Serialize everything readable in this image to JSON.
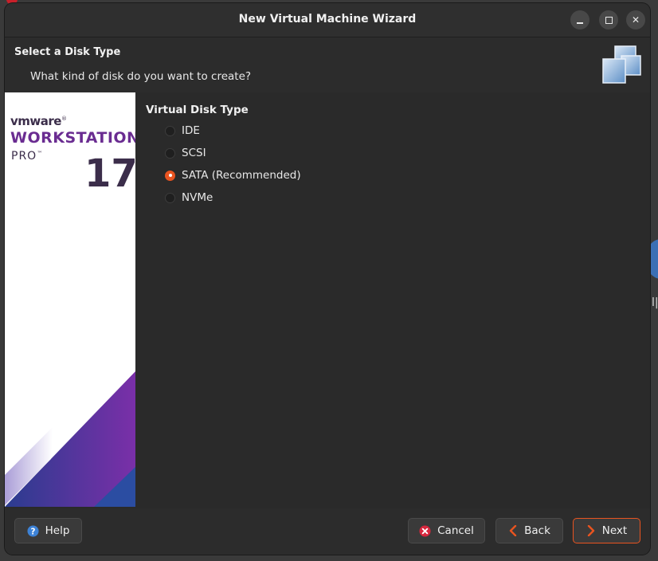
{
  "window": {
    "title": "New Virtual Machine Wizard"
  },
  "header": {
    "title": "Select a Disk Type",
    "subtitle": "What kind of disk do you want to create?",
    "icon": "virtual-disks-icon"
  },
  "branding": {
    "vendor": "vmware",
    "product_line1": "WORKSTATION",
    "product_line2": "PRO",
    "trademark": "™",
    "version": "17"
  },
  "disk_type": {
    "group_label": "Virtual Disk Type",
    "options": [
      {
        "label": "IDE",
        "selected": false
      },
      {
        "label": "SCSI",
        "selected": false
      },
      {
        "label": "SATA (Recommended)",
        "selected": true
      },
      {
        "label": "NVMe",
        "selected": false
      }
    ]
  },
  "footer": {
    "help_label": "Help",
    "cancel_label": "Cancel",
    "back_label": "Back",
    "next_label": "Next"
  },
  "colors": {
    "accent": "#e95420",
    "brand_purple": "#6a2c91"
  }
}
